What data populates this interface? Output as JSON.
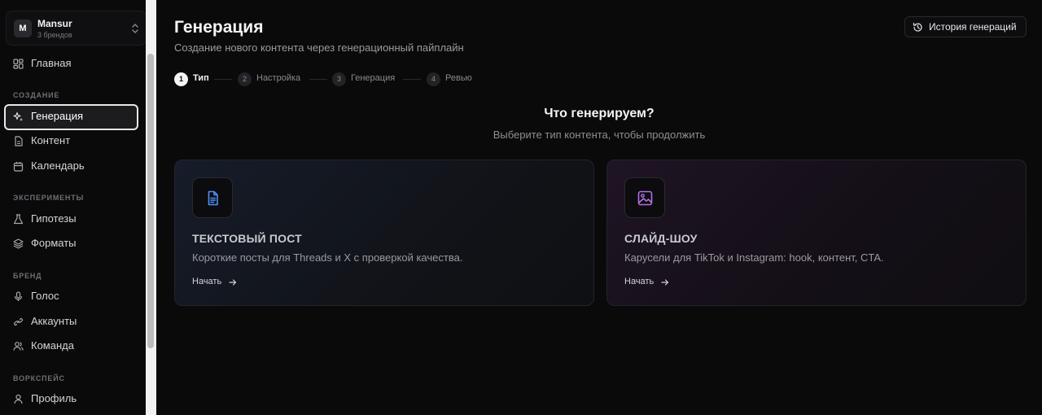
{
  "workspace": {
    "initial": "M",
    "name": "Mansur",
    "subtitle": "3 брендов"
  },
  "sidebar": {
    "home": {
      "label": "Главная",
      "icon": "grid-icon"
    },
    "sections": [
      {
        "title": "СОЗДАНИЕ",
        "items": [
          {
            "label": "Генерация",
            "icon": "sparkles-icon",
            "active": true
          },
          {
            "label": "Контент",
            "icon": "document-icon"
          },
          {
            "label": "Календарь",
            "icon": "calendar-icon"
          }
        ]
      },
      {
        "title": "ЭКСПЕРИМЕНТЫ",
        "items": [
          {
            "label": "Гипотезы",
            "icon": "flask-icon"
          },
          {
            "label": "Форматы",
            "icon": "layers-icon"
          }
        ]
      },
      {
        "title": "БРЕНД",
        "items": [
          {
            "label": "Голос",
            "icon": "microphone-icon"
          },
          {
            "label": "Аккаунты",
            "icon": "link-icon"
          },
          {
            "label": "Команда",
            "icon": "users-icon"
          }
        ]
      },
      {
        "title": "ВОРКСПЕЙС",
        "items": [
          {
            "label": "Профиль",
            "icon": "user-icon"
          }
        ]
      }
    ]
  },
  "header": {
    "title": "Генерация",
    "subtitle": "Создание нового контента через генерационный пайплайн",
    "history_button": "История генераций"
  },
  "steps": [
    {
      "num": "1",
      "label": "Тип",
      "current": true
    },
    {
      "num": "2",
      "label": "Настройка"
    },
    {
      "num": "3",
      "label": "Генерация"
    },
    {
      "num": "4",
      "label": "Ревью"
    }
  ],
  "question": {
    "title": "Что генерируем?",
    "subtitle": "Выберите тип контента, чтобы продолжить"
  },
  "cards": [
    {
      "title": "ТЕКСТОВЫЙ ПОСТ",
      "description": "Короткие посты для Threads и X с проверкой качества.",
      "cta": "Начать",
      "icon": "document-icon",
      "icon_color": "#4f8ff7"
    },
    {
      "title": "СЛАЙД-ШОУ",
      "description": "Карусели для TikTok и Instagram: hook, контент, CTA.",
      "cta": "Начать",
      "icon": "image-icon",
      "icon_color": "#b46ee8"
    }
  ]
}
